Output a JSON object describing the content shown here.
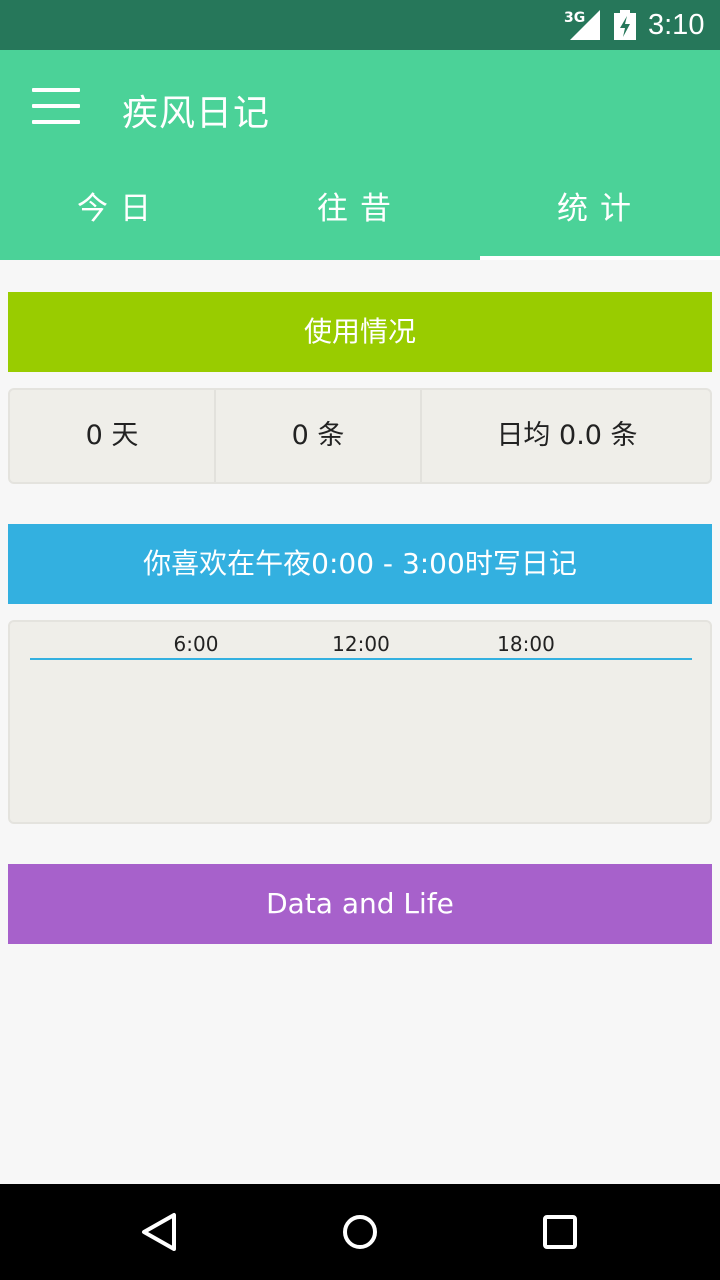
{
  "status_bar": {
    "network": "3G",
    "time": "3:10",
    "icons": [
      "signal-icon",
      "battery-charging-icon"
    ]
  },
  "app_bar": {
    "title": "疾风日记",
    "menu_icon": "hamburger-menu-icon",
    "background": "#4bd298"
  },
  "tabs": [
    {
      "label": "今日",
      "selected": false
    },
    {
      "label": "往昔",
      "selected": false
    },
    {
      "label": "统计",
      "selected": true
    }
  ],
  "usage": {
    "header": "使用情况",
    "color": "#99cc00",
    "days": "0 天",
    "entries": "0 条",
    "daily_average": "日均 0.0 条"
  },
  "time_of_day": {
    "header": "你喜欢在午夜0:00 - 3:00时写日记",
    "color": "#33b0e0",
    "ticks": [
      "6:00",
      "12:00",
      "18:00"
    ]
  },
  "life": {
    "header": "Data and Life",
    "color": "#a761cb"
  },
  "nav_bar": {
    "buttons": [
      "back-icon",
      "home-icon",
      "recents-icon"
    ]
  }
}
